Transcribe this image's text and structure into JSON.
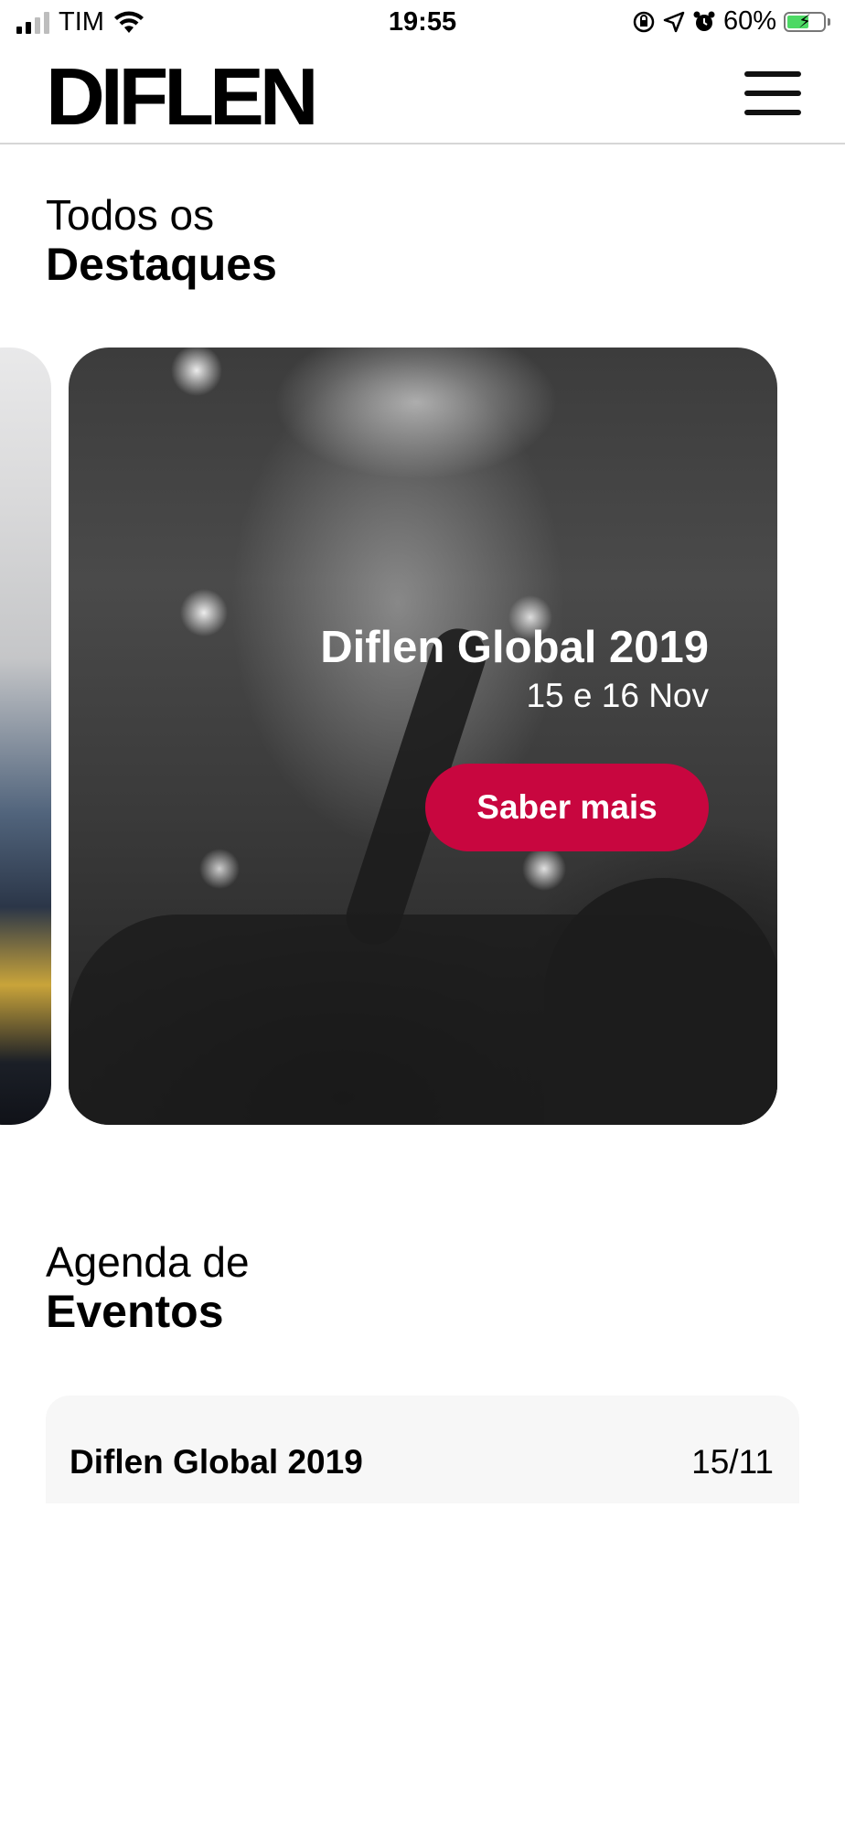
{
  "status_bar": {
    "carrier": "TIM",
    "time": "19:55",
    "battery_percent": "60%",
    "battery_level": 0.6,
    "icons": [
      "signal-icon",
      "wifi-icon",
      "orientation-lock-icon",
      "location-icon",
      "alarm-icon",
      "battery-icon"
    ]
  },
  "header": {
    "logo_text": "DIFLEN",
    "menu_icon": "hamburger-menu-icon"
  },
  "highlights": {
    "title_light": "Todos os",
    "title_bold": "Destaques",
    "cards": [
      {
        "title": "Diflen Global 2019",
        "date": "15 e 16 Nov",
        "button_label": "Saber mais"
      }
    ]
  },
  "events": {
    "title_light": "Agenda de",
    "title_bold": "Eventos",
    "items": [
      {
        "name": "Diflen Global 2019",
        "date": "15/11"
      }
    ]
  },
  "colors": {
    "accent": "#c8063f",
    "event_bg": "#f7f7f7",
    "divider": "#d6d6d6"
  }
}
